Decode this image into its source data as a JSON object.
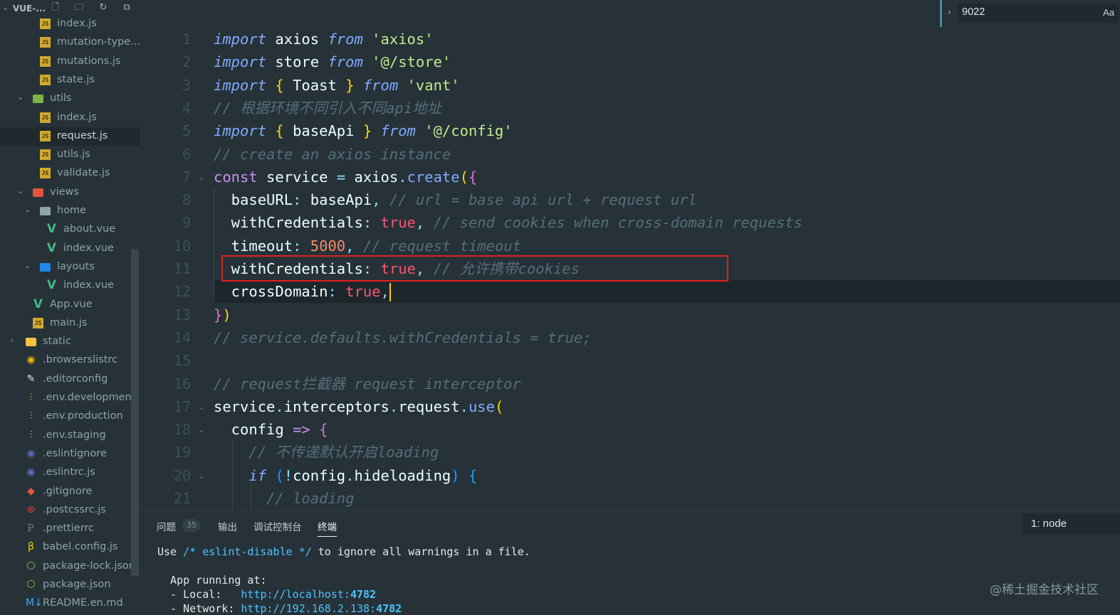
{
  "explorer": {
    "title": "VUE-...",
    "items": [
      {
        "label": "index.js",
        "icon": "js"
      },
      {
        "label": "mutation-type...",
        "icon": "js"
      },
      {
        "label": "mutations.js",
        "icon": "js"
      },
      {
        "label": "state.js",
        "icon": "js"
      },
      {
        "label": "utils",
        "icon": "folder-green"
      },
      {
        "label": "index.js",
        "icon": "js"
      },
      {
        "label": "request.js",
        "icon": "js"
      },
      {
        "label": "utils.js",
        "icon": "js"
      },
      {
        "label": "validate.js",
        "icon": "js"
      },
      {
        "label": "views",
        "icon": "folder-red"
      },
      {
        "label": "home",
        "icon": "folder-gray"
      },
      {
        "label": "about.vue",
        "icon": "vue"
      },
      {
        "label": "index.vue",
        "icon": "vue"
      },
      {
        "label": "layouts",
        "icon": "folder-blue"
      },
      {
        "label": "index.vue",
        "icon": "vue"
      },
      {
        "label": "App.vue",
        "icon": "vue"
      },
      {
        "label": "main.js",
        "icon": "js"
      },
      {
        "label": "static",
        "icon": "folder-yellow"
      },
      {
        "label": ".browserslistrc",
        "icon": "browserslist"
      },
      {
        "label": ".editorconfig",
        "icon": "editorconfig"
      },
      {
        "label": ".env.development",
        "icon": "env"
      },
      {
        "label": ".env.production",
        "icon": "env"
      },
      {
        "label": ".env.staging",
        "icon": "env"
      },
      {
        "label": ".eslintignore",
        "icon": "eslint"
      },
      {
        "label": ".eslintrc.js",
        "icon": "eslint"
      },
      {
        "label": ".gitignore",
        "icon": "git"
      },
      {
        "label": ".postcssrc.js",
        "icon": "postcss"
      },
      {
        "label": ".prettierrc",
        "icon": "prettier"
      },
      {
        "label": "babel.config.js",
        "icon": "babel"
      },
      {
        "label": "package-lock.json",
        "icon": "node"
      },
      {
        "label": "package.json",
        "icon": "node"
      },
      {
        "label": "README.en.md",
        "icon": "markdown"
      }
    ],
    "active": "request.js"
  },
  "find_widget": {
    "query": "9022",
    "match_case_label": "Aa"
  },
  "editor": {
    "line_numbers": [
      "1",
      "2",
      "3",
      "4",
      "5",
      "6",
      "7",
      "8",
      "9",
      "10",
      "11",
      "12",
      "13",
      "14",
      "15",
      "16",
      "17",
      "18",
      "19",
      "20",
      "21"
    ],
    "lines": [
      [
        [
          "kw",
          "import"
        ],
        [
          "var",
          " axios "
        ],
        [
          "kw",
          "from"
        ],
        [
          "str",
          " 'axios'"
        ]
      ],
      [
        [
          "kw",
          "import"
        ],
        [
          "var",
          " store "
        ],
        [
          "kw",
          "from"
        ],
        [
          "str",
          " '@/store'"
        ]
      ],
      [
        [
          "kw",
          "import"
        ],
        [
          "br1",
          " {"
        ],
        [
          "var",
          " Toast "
        ],
        [
          "br1",
          "}"
        ],
        [
          "kw",
          " from"
        ],
        [
          "str",
          " 'vant'"
        ]
      ],
      [
        [
          "cm",
          "// 根据环境不同引入不同api地址"
        ]
      ],
      [
        [
          "kw",
          "import"
        ],
        [
          "br1",
          " {"
        ],
        [
          "var",
          " baseApi "
        ],
        [
          "br1",
          "}"
        ],
        [
          "kw",
          " from"
        ],
        [
          "str",
          " '@/config'"
        ]
      ],
      [
        [
          "cm",
          "// create an axios instance"
        ]
      ],
      [
        [
          "ct",
          "const"
        ],
        [
          "var",
          " service "
        ],
        [
          "op",
          "="
        ],
        [
          "var",
          " axios"
        ],
        [
          "op",
          "."
        ],
        [
          "fn",
          "create"
        ],
        [
          "br1",
          "("
        ],
        [
          "br2",
          "{"
        ]
      ],
      [
        [
          "var",
          "  baseURL"
        ],
        [
          "op",
          ":"
        ],
        [
          "var",
          " baseApi"
        ],
        [
          "op",
          ","
        ],
        [
          "cm",
          " // url = base api url + request url"
        ]
      ],
      [
        [
          "var",
          "  withCredentials"
        ],
        [
          "op",
          ":"
        ],
        [
          "bool",
          " true"
        ],
        [
          "op",
          ","
        ],
        [
          "cm",
          " // send cookies when cross-domain requests"
        ]
      ],
      [
        [
          "var",
          "  timeout"
        ],
        [
          "op",
          ":"
        ],
        [
          "num",
          " 5000"
        ],
        [
          "op",
          ","
        ],
        [
          "cm",
          " // request timeout"
        ]
      ],
      [
        [
          "var",
          "  withCredentials"
        ],
        [
          "op",
          ":"
        ],
        [
          "bool",
          " true"
        ],
        [
          "op",
          ","
        ],
        [
          "cm",
          " // 允许携带cookies"
        ]
      ],
      [
        [
          "var",
          "  crossDomain"
        ],
        [
          "op",
          ":"
        ],
        [
          "bool",
          " true"
        ],
        [
          "op",
          ","
        ]
      ],
      [
        [
          "br2",
          "}"
        ],
        [
          "br1",
          ")"
        ]
      ],
      [
        [
          "cm",
          "// service.defaults.withCredentials = true;"
        ]
      ],
      [],
      [
        [
          "cm",
          "// request拦截器 request interceptor"
        ]
      ],
      [
        [
          "var",
          "service"
        ],
        [
          "op",
          "."
        ],
        [
          "var",
          "interceptors"
        ],
        [
          "op",
          "."
        ],
        [
          "var",
          "request"
        ],
        [
          "op",
          "."
        ],
        [
          "fn",
          "use"
        ],
        [
          "br1",
          "("
        ]
      ],
      [
        [
          "var",
          "  config "
        ],
        [
          "ct",
          "=>"
        ],
        [
          "br2",
          " {"
        ]
      ],
      [
        [
          "cm",
          "    // 不传递默认开启loading"
        ]
      ],
      [
        [
          "kw",
          "    if"
        ],
        [
          "br3",
          " ("
        ],
        [
          "op",
          "!"
        ],
        [
          "var",
          "config"
        ],
        [
          "op",
          "."
        ],
        [
          "var",
          "hideloading"
        ],
        [
          "br3",
          ")"
        ],
        [
          "br3",
          " {"
        ]
      ],
      [
        [
          "cm",
          "      // loading"
        ]
      ]
    ]
  },
  "panel": {
    "tabs": [
      {
        "label": "问题"
      },
      {
        "label": "输出"
      },
      {
        "label": "调试控制台"
      },
      {
        "label": "终端"
      }
    ],
    "problems_count": "35",
    "terminal_select": "1: node",
    "terminal": {
      "l1_pre": "Use ",
      "l1_cm": "/* eslint-disable */",
      "l1_post": " to ignore all warnings in a file.",
      "l2": "  App running at:",
      "l3_pre": "  - Local:   ",
      "l3_url": "http://localhost:",
      "l3_port": "4782",
      "l4_pre": "  - Network: ",
      "l4_url": "http://192.168.2.138:",
      "l4_port": "4782"
    }
  },
  "watermark": "@稀土掘金技术社区",
  "colors": {
    "background": "#263238",
    "keyword": "#82aaff",
    "string": "#c3e88d",
    "comment": "#546e7a",
    "boolean": "#ff5370",
    "number": "#f78c6c",
    "highlight_box": "#e02020",
    "cursor": "#ffcc00"
  }
}
